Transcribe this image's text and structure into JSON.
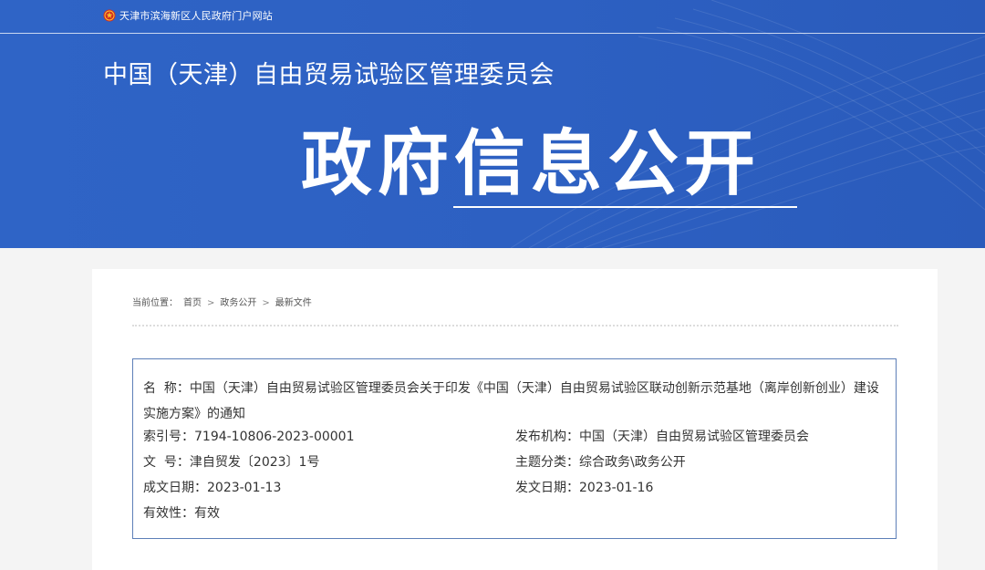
{
  "header": {
    "portal_name": "天津市滨海新区人民政府门户网站",
    "org_title": "中国（天津）自由贸易试验区管理委员会",
    "hero_title": "政府信息公开"
  },
  "breadcrumb": {
    "prefix": "当前位置：",
    "items": [
      "首页",
      "政务公开",
      "最新文件"
    ],
    "separator": ">"
  },
  "document": {
    "name_label": "名  称：",
    "name_value": "中国（天津）自由贸易试验区管理委员会关于印发《中国（天津）自由贸易试验区联动创新示范基地（离岸创新创业）建设实施方案》的通知",
    "index_label": "索引号：",
    "index_value": "7194-10806-2023-00001",
    "publisher_label": "发布机构：",
    "publisher_value": "中国（天津）自由贸易试验区管理委员会",
    "doc_no_label": "文  号：",
    "doc_no_value": "津自贸发〔2023〕1号",
    "topic_label": "主题分类：",
    "topic_value": "综合政务\\政务公开",
    "created_label": "成文日期：",
    "created_value": "2023-01-13",
    "issued_label": "发文日期：",
    "issued_value": "2023-01-16",
    "validity_label": "有效性：",
    "validity_value": "有效"
  },
  "colors": {
    "banner_blue": "#2d60c2",
    "box_border": "#5d7fb8",
    "text": "#333333",
    "page_bg": "#f4f4f4"
  },
  "icons": {
    "portal_emblem": "national-emblem-icon"
  }
}
